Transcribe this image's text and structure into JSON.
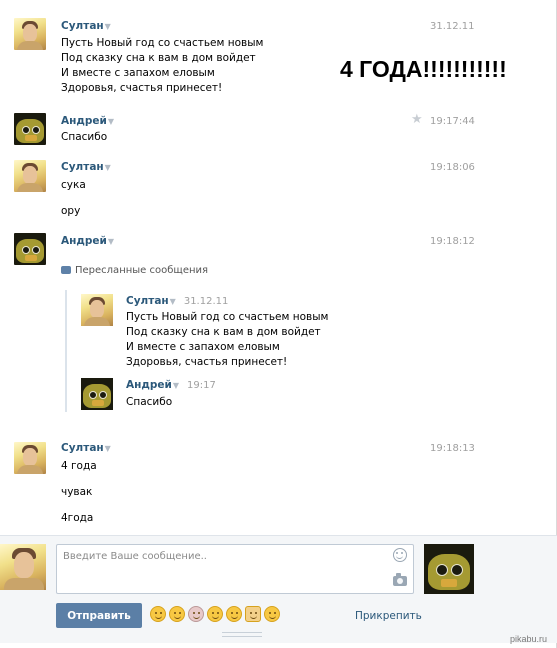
{
  "note": "4 ГОДА!!!!!!!!!!!",
  "messages": [
    {
      "author": "Султан",
      "caret": "▼",
      "time": "31.12.11",
      "lines": [
        "Пусть Новый год со счастьем новым",
        "Под сказку сна к вам в дом войдет",
        "И вместе с запахом еловым",
        "Здоровья, счастья принесет!"
      ]
    },
    {
      "author": "Андрей",
      "caret": "▼",
      "time": "19:17:44",
      "star": "★",
      "lines": [
        "Спасибо"
      ]
    },
    {
      "author": "Султан",
      "caret": "▼",
      "time": "19:18:06",
      "lines": [
        "сука",
        "ору"
      ]
    },
    {
      "author": "Андрей",
      "caret": "▼",
      "time": "19:18:12",
      "forwarded_label": "Пересланные сообщения",
      "forwarded": [
        {
          "author": "Султан",
          "caret": "▼",
          "time": "31.12.11",
          "lines": [
            "Пусть Новый год со счастьем новым",
            "Под сказку сна к вам в дом войдет",
            "И вместе с запахом еловым",
            "Здоровья, счастья принесет!"
          ]
        },
        {
          "author": "Андрей",
          "caret": "▼",
          "time": "19:17",
          "lines": [
            "Спасибо"
          ]
        }
      ]
    },
    {
      "author": "Султан",
      "caret": "▼",
      "time": "19:18:13",
      "lines": [
        "4 года",
        "чувак",
        "4года"
      ]
    }
  ],
  "composer": {
    "placeholder": "Введите Ваше сообщение..",
    "send_label": "Отправить",
    "attach_label": "Прикрепить",
    "emojis": [
      "relieved-emoji",
      "laughing-emoji",
      "mouse-emoji",
      "blush-emoji",
      "smile-emoji",
      "thumbs-up-emoji",
      "flushed-emoji"
    ]
  },
  "watermark": "pikabu.ru"
}
